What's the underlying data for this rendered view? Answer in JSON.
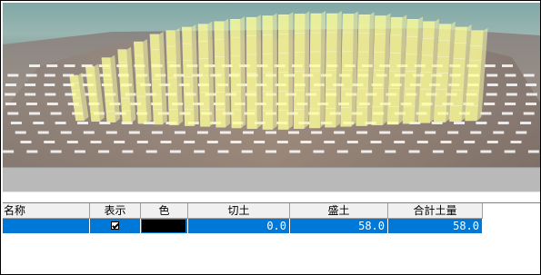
{
  "scene": {
    "fill_color": "#ffff99",
    "base_color": "#ffffff"
  },
  "table": {
    "columns": [
      {
        "key": "name",
        "label": "名称"
      },
      {
        "key": "display",
        "label": "表示"
      },
      {
        "key": "color",
        "label": "色"
      },
      {
        "key": "cut",
        "label": "切土"
      },
      {
        "key": "fill",
        "label": "盛土"
      },
      {
        "key": "total",
        "label": "合計土量"
      }
    ],
    "rows": [
      {
        "name": "",
        "display": true,
        "color": "#000000",
        "cut": "0.0",
        "fill": "58.0",
        "total": "58.0"
      }
    ],
    "selection_color": "#0078d7"
  }
}
